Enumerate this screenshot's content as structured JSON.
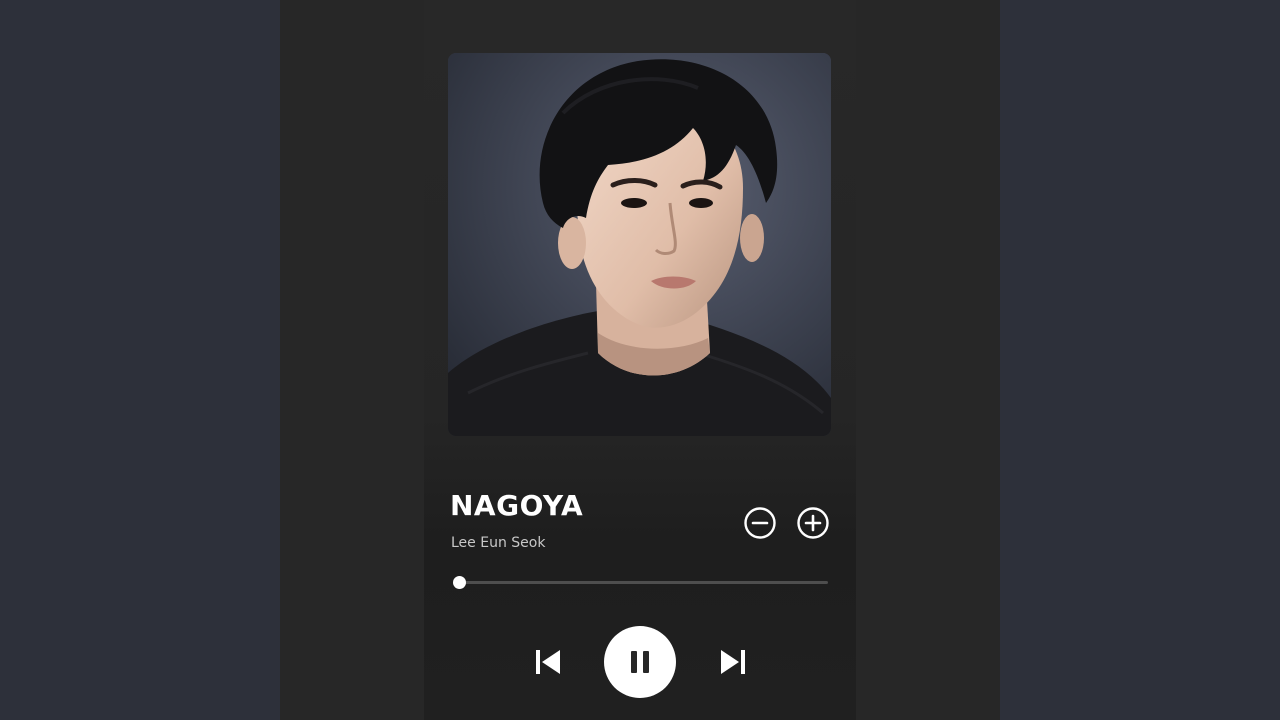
{
  "track": {
    "title": "NAGOYA",
    "artist": "Lee Eun Seok",
    "progress_fraction": 0.0,
    "is_playing": true
  },
  "icons": {
    "remove": "minus-circle-icon",
    "add": "plus-circle-icon",
    "previous": "skip-previous-icon",
    "pause": "pause-icon",
    "next": "skip-next-icon"
  },
  "colors": {
    "background": "#2d303a",
    "card": "#272727",
    "text_primary": "#ffffff",
    "text_secondary": "#c8c8c8",
    "track": "#4e4e4e"
  }
}
